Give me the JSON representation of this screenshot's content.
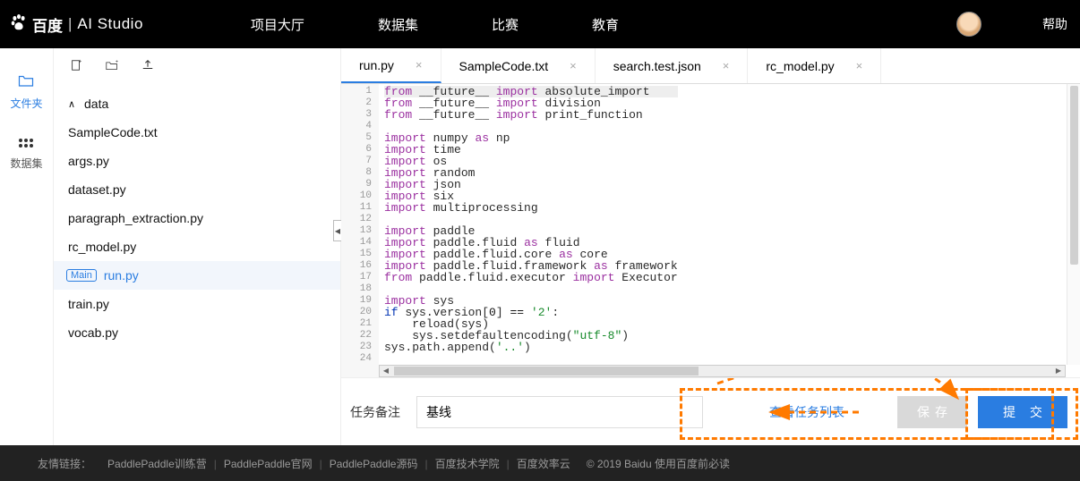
{
  "header": {
    "logo_baidu": "百度",
    "logo_ai": "AI Studio",
    "nav": [
      "项目大厅",
      "数据集",
      "比赛",
      "教育"
    ],
    "help": "帮助"
  },
  "rail": {
    "files": "文件夹",
    "datasets": "数据集"
  },
  "tree": {
    "root": "data",
    "items": [
      "SampleCode.txt",
      "args.py",
      "dataset.py",
      "paragraph_extraction.py",
      "rc_model.py",
      "run.py",
      "train.py",
      "vocab.py"
    ],
    "main_badge": "Main",
    "selected": "run.py"
  },
  "tabs": [
    "run.py",
    "SampleCode.txt",
    "search.test.json",
    "rc_model.py"
  ],
  "code": {
    "lines": [
      {
        "n": 1,
        "h": "<span class='k-purple'>from</span> <span class='k-text'>__future__</span> <span class='k-purple'>import</span> <span class='k-text'>absolute_import</span>"
      },
      {
        "n": 2,
        "h": "<span class='k-purple'>from</span> <span class='k-text'>__future__</span> <span class='k-purple'>import</span> <span class='k-text'>division</span>"
      },
      {
        "n": 3,
        "h": "<span class='k-purple'>from</span> <span class='k-text'>__future__</span> <span class='k-purple'>import</span> <span class='k-text'>print_function</span>"
      },
      {
        "n": 4,
        "h": ""
      },
      {
        "n": 5,
        "h": "<span class='k-purple'>import</span> <span class='k-text'>numpy</span> <span class='k-purple'>as</span> <span class='k-text'>np</span>"
      },
      {
        "n": 6,
        "h": "<span class='k-purple'>import</span> <span class='k-text'>time</span>"
      },
      {
        "n": 7,
        "h": "<span class='k-purple'>import</span> <span class='k-text'>os</span>"
      },
      {
        "n": 8,
        "h": "<span class='k-purple'>import</span> <span class='k-text'>random</span>"
      },
      {
        "n": 9,
        "h": "<span class='k-purple'>import</span> <span class='k-text'>json</span>"
      },
      {
        "n": 10,
        "h": "<span class='k-purple'>import</span> <span class='k-text'>six</span>"
      },
      {
        "n": 11,
        "h": "<span class='k-purple'>import</span> <span class='k-text'>multiprocessing</span>"
      },
      {
        "n": 12,
        "h": ""
      },
      {
        "n": 13,
        "h": "<span class='k-purple'>import</span> <span class='k-text'>paddle</span>"
      },
      {
        "n": 14,
        "h": "<span class='k-purple'>import</span> <span class='k-text'>paddle.fluid</span> <span class='k-purple'>as</span> <span class='k-text'>fluid</span>"
      },
      {
        "n": 15,
        "h": "<span class='k-purple'>import</span> <span class='k-text'>paddle.fluid.core</span> <span class='k-purple'>as</span> <span class='k-text'>core</span>"
      },
      {
        "n": 16,
        "h": "<span class='k-purple'>import</span> <span class='k-text'>paddle.fluid.framework</span> <span class='k-purple'>as</span> <span class='k-text'>framework</span>"
      },
      {
        "n": 17,
        "h": "<span class='k-purple'>from</span> <span class='k-text'>paddle.fluid.executor</span> <span class='k-purple'>import</span> <span class='k-text'>Executor</span>"
      },
      {
        "n": 18,
        "h": ""
      },
      {
        "n": 19,
        "h": "<span class='k-purple'>import</span> <span class='k-text'>sys</span>"
      },
      {
        "n": 20,
        "h": "<span class='k-blue'>if</span> <span class='k-text'>sys.version[</span><span class='k-op'>0</span><span class='k-text'>]</span> <span class='k-op'>==</span> <span class='k-str'>'2'</span><span class='k-text'>:</span>",
        "arrow": true
      },
      {
        "n": 21,
        "h": "    <span class='k-text'>reload(sys)</span>"
      },
      {
        "n": 22,
        "h": "    <span class='k-text'>sys.setdefaultencoding(</span><span class='k-str'>\"utf-8\"</span><span class='k-text'>)</span>"
      },
      {
        "n": 23,
        "h": "<span class='k-text'>sys.path.append(</span><span class='k-str'>'..'</span><span class='k-text'>)</span>"
      },
      {
        "n": 24,
        "h": ""
      }
    ]
  },
  "bottom": {
    "task_label": "任务备注",
    "task_value": "基线",
    "view_link": "查看任务列表",
    "save": "保存",
    "submit": "提 交"
  },
  "footer": {
    "label": "友情链接：",
    "links": [
      "PaddlePaddle训练营",
      "PaddlePaddle官网",
      "PaddlePaddle源码",
      "百度技术学院",
      "百度效率云"
    ],
    "copyright": "© 2019 Baidu 使用百度前必读"
  }
}
